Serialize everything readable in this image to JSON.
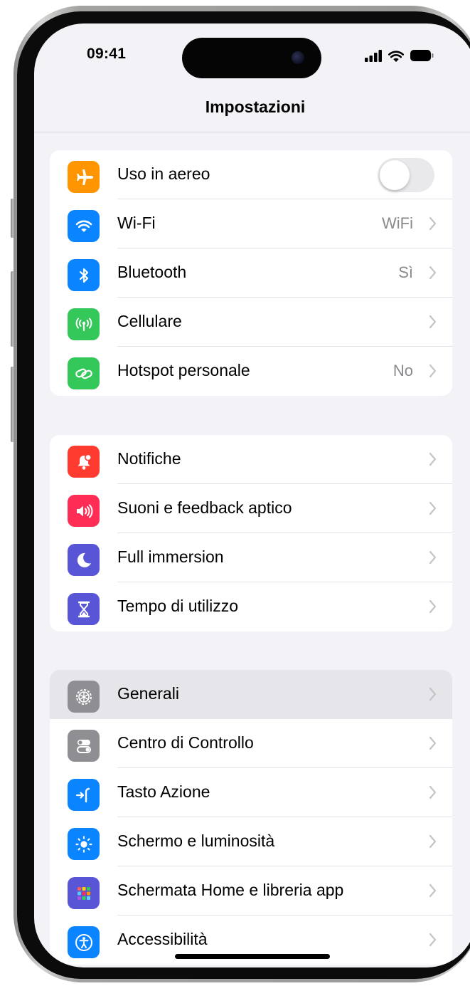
{
  "status_bar": {
    "time": "09:41"
  },
  "nav": {
    "title": "Impostazioni"
  },
  "colors": {
    "orange": "#ff9500",
    "blue": "#0a84ff",
    "green": "#34c759",
    "red": "#ff3b30",
    "pink": "#ff2d55",
    "indigo": "#5856d6",
    "gray": "#8e8e93"
  },
  "groups": [
    {
      "rows": [
        {
          "label": "Uso in aereo",
          "icon": "airplane-icon",
          "toggle": false
        },
        {
          "label": "Wi-Fi",
          "icon": "wifi-icon",
          "value": "WiFi"
        },
        {
          "label": "Bluetooth",
          "icon": "bluetooth-icon",
          "value": "Sì"
        },
        {
          "label": "Cellulare",
          "icon": "cellular-antenna-icon",
          "value": ""
        },
        {
          "label": "Hotspot personale",
          "icon": "hotspot-link-icon",
          "value": "No"
        }
      ]
    },
    {
      "rows": [
        {
          "label": "Notifiche",
          "icon": "bell-badge-icon"
        },
        {
          "label": "Suoni e feedback aptico",
          "icon": "speaker-icon"
        },
        {
          "label": "Full immersion",
          "icon": "moon-icon"
        },
        {
          "label": "Tempo di utilizzo",
          "icon": "hourglass-icon"
        }
      ]
    },
    {
      "rows": [
        {
          "label": "Generali",
          "icon": "gear-icon",
          "highlighted": true
        },
        {
          "label": "Centro di Controllo",
          "icon": "switches-icon"
        },
        {
          "label": "Tasto Azione",
          "icon": "action-button-icon"
        },
        {
          "label": "Schermo e luminosità",
          "icon": "sun-icon"
        },
        {
          "label": "Schermata Home e libreria app",
          "icon": "app-grid-icon"
        },
        {
          "label": "Accessibilità",
          "icon": "accessibility-icon"
        }
      ]
    }
  ]
}
